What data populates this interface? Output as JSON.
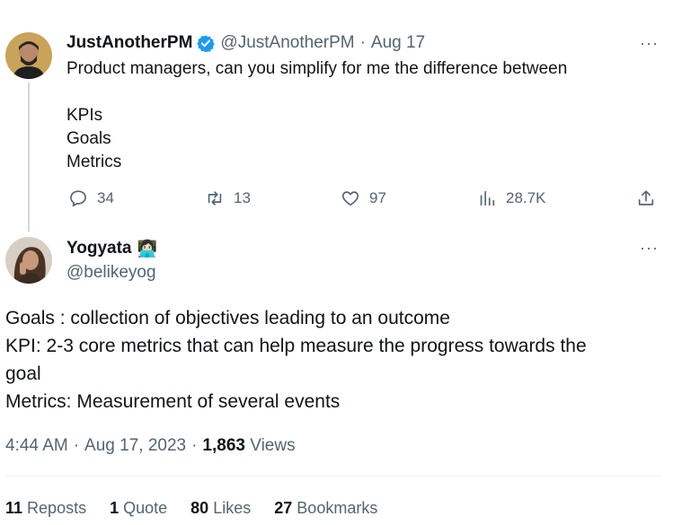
{
  "tweet": {
    "display_name": "JustAnotherPM",
    "handle": "@JustAnotherPM",
    "separator": "·",
    "date": "Aug 17",
    "more": "···",
    "text_line1": "Product managers, can you simplify for me the difference between",
    "list": [
      "KPIs",
      "Goals",
      "Metrics"
    ],
    "actions": {
      "replies": "34",
      "reposts": "13",
      "likes": "97",
      "views": "28.7K"
    }
  },
  "reply": {
    "display_name": "Yogyata",
    "emoji": "👩🏻‍💻",
    "handle": "@belikeyog",
    "more": "···",
    "lines": [
      "Goals : collection of objectives leading to an outcome",
      "KPI: 2-3 core metrics that can help measure the progress towards the",
      "goal",
      "Metrics: Measurement of several events"
    ],
    "meta": {
      "time": "4:44 AM",
      "sep1": "·",
      "date": "Aug 17, 2023",
      "sep2": "·",
      "views_count": "1,863",
      "views_label": "Views"
    },
    "stats": {
      "reposts_count": "11",
      "reposts_label": "Reposts",
      "quote_count": "1",
      "quote_label": "Quote",
      "likes_count": "80",
      "likes_label": "Likes",
      "bookmarks_count": "27",
      "bookmarks_label": "Bookmarks"
    }
  },
  "colors": {
    "text": "#0f1419",
    "muted": "#536471",
    "verified": "#1d9bf0",
    "divider": "#eff3f4"
  }
}
